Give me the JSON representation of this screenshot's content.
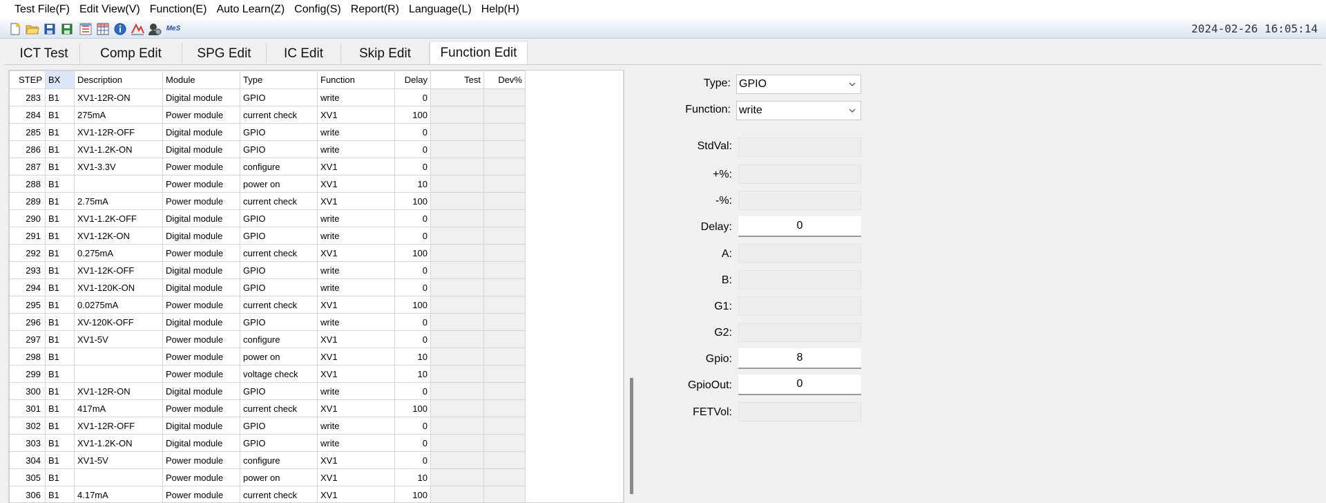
{
  "menu": [
    "Test File(F)",
    "Edit View(V)",
    "Function(E)",
    "Auto Learn(Z)",
    "Config(S)",
    "Report(R)",
    "Language(L)",
    "Help(H)"
  ],
  "toolbar": {
    "icons": [
      "new-file-icon",
      "open-folder-icon",
      "save-icon",
      "save-all-icon",
      "list-icon",
      "grid-icon",
      "info-icon",
      "chart-icon",
      "user-settings-icon",
      "mes-icon"
    ],
    "mes_label": "MeS"
  },
  "datetime": "2024-02-26 16:05:14",
  "tabs": [
    "ICT Test",
    "Comp Edit",
    "SPG Edit",
    "IC Edit",
    "Skip Edit",
    "Function Edit"
  ],
  "grid": {
    "headers": [
      "STEP",
      "BX",
      "Description",
      "Module",
      "Type",
      "Function",
      "Delay",
      "Test",
      "Dev%"
    ],
    "rows": [
      [
        "283",
        "B1",
        "XV1-12R-ON",
        "Digital module",
        "GPIO",
        "write",
        "0"
      ],
      [
        "284",
        "B1",
        "275mA",
        "Power module",
        "current check",
        "XV1",
        "100"
      ],
      [
        "285",
        "B1",
        "XV1-12R-OFF",
        "Digital module",
        "GPIO",
        "write",
        "0"
      ],
      [
        "286",
        "B1",
        "XV1-1.2K-ON",
        "Digital module",
        "GPIO",
        "write",
        "0"
      ],
      [
        "287",
        "B1",
        "XV1-3.3V",
        "Power module",
        "configure",
        "XV1",
        "0"
      ],
      [
        "288",
        "B1",
        "",
        "Power module",
        "power on",
        "XV1",
        "10"
      ],
      [
        "289",
        "B1",
        "2.75mA",
        "Power module",
        "current check",
        "XV1",
        "100"
      ],
      [
        "290",
        "B1",
        "XV1-1.2K-OFF",
        "Digital module",
        "GPIO",
        "write",
        "0"
      ],
      [
        "291",
        "B1",
        "XV1-12K-ON",
        "Digital module",
        "GPIO",
        "write",
        "0"
      ],
      [
        "292",
        "B1",
        "0.275mA",
        "Power module",
        "current check",
        "XV1",
        "100"
      ],
      [
        "293",
        "B1",
        "XV1-12K-OFF",
        "Digital module",
        "GPIO",
        "write",
        "0"
      ],
      [
        "294",
        "B1",
        "XV1-120K-ON",
        "Digital module",
        "GPIO",
        "write",
        "0"
      ],
      [
        "295",
        "B1",
        "0.0275mA",
        "Power module",
        "current check",
        "XV1",
        "100"
      ],
      [
        "296",
        "B1",
        "XV-120K-OFF",
        "Digital module",
        "GPIO",
        "write",
        "0"
      ],
      [
        "297",
        "B1",
        "XV1-5V",
        "Power module",
        "configure",
        "XV1",
        "0"
      ],
      [
        "298",
        "B1",
        "",
        "Power module",
        "power on",
        "XV1",
        "10"
      ],
      [
        "299",
        "B1",
        "",
        "Power module",
        "voltage check",
        "XV1",
        "10"
      ],
      [
        "300",
        "B1",
        "XV1-12R-ON",
        "Digital module",
        "GPIO",
        "write",
        "0"
      ],
      [
        "301",
        "B1",
        "417mA",
        "Power module",
        "current check",
        "XV1",
        "100"
      ],
      [
        "302",
        "B1",
        "XV1-12R-OFF",
        "Digital module",
        "GPIO",
        "write",
        "0"
      ],
      [
        "303",
        "B1",
        "XV1-1.2K-ON",
        "Digital module",
        "GPIO",
        "write",
        "0"
      ],
      [
        "304",
        "B1",
        "XV1-5V",
        "Power module",
        "configure",
        "XV1",
        "0"
      ],
      [
        "305",
        "B1",
        "",
        "Power module",
        "power on",
        "XV1",
        "10"
      ],
      [
        "306",
        "B1",
        "4.17mA",
        "Power module",
        "current check",
        "XV1",
        "100"
      ]
    ]
  },
  "panel": {
    "type_label": "Type:",
    "type_value": "GPIO",
    "function_label": "Function:",
    "function_value": "write",
    "stdval_label": "StdVal:",
    "plus_label": "+%:",
    "minus_label": "-%:",
    "delay_label": "Delay:",
    "delay_value": "0",
    "a_label": "A:",
    "b_label": "B:",
    "g1_label": "G1:",
    "g2_label": "G2:",
    "gpio_label": "Gpio:",
    "gpio_value": "8",
    "gpioout_label": "GpioOut:",
    "gpioout_value": "0",
    "fetvol_label": "FETVol:"
  }
}
